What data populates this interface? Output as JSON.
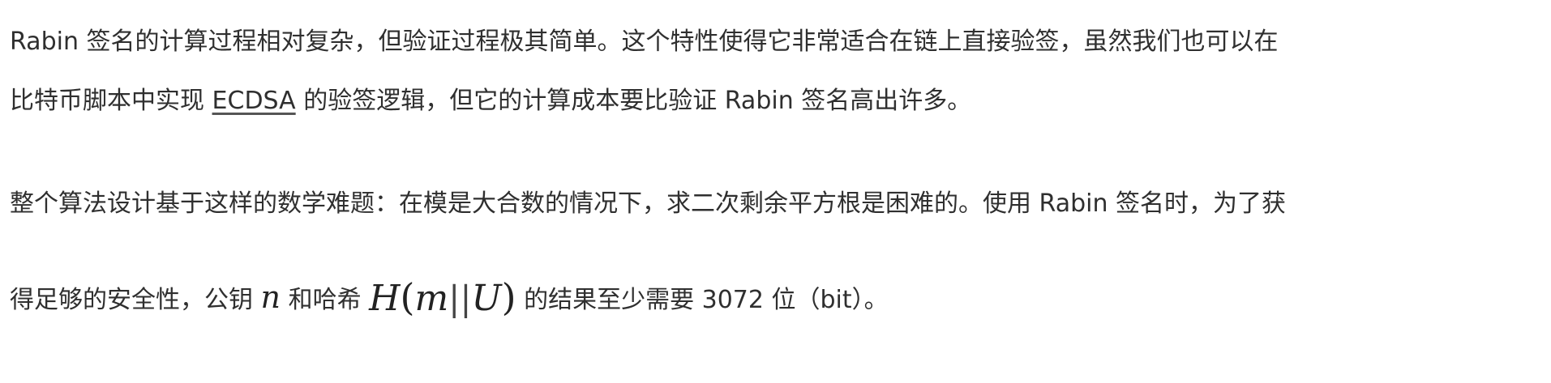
{
  "paragraphs": {
    "p1": {
      "line1": "Rabin 签名的计算过程相对复杂，但验证过程极其简单。这个特性使得它非常适合在链上直接验签，虽然我们也可以在",
      "line2_before_link": "比特币脚本中实现 ",
      "link_text": "ECDSA",
      "line2_after_link": " 的验签逻辑，但它的计算成本要比验证 Rabin 签名高出许多。"
    },
    "p2": {
      "line1": "整个算法设计基于这样的数学难题：在模是大合数的情况下，求二次剩余平方根是困难的。使用 Rabin 签名时，为了获",
      "line2_part1": "得足够的安全性，公钥 ",
      "math_n": "n",
      "line2_part2": " 和哈希 ",
      "math_H": "H",
      "math_lparen": "(",
      "math_m": "m",
      "math_bar1": "|",
      "math_bar2": "|",
      "math_U": "U",
      "math_rparen": ")",
      "line2_part3": " 的结果至少需要 3072 位（bit）。"
    }
  }
}
